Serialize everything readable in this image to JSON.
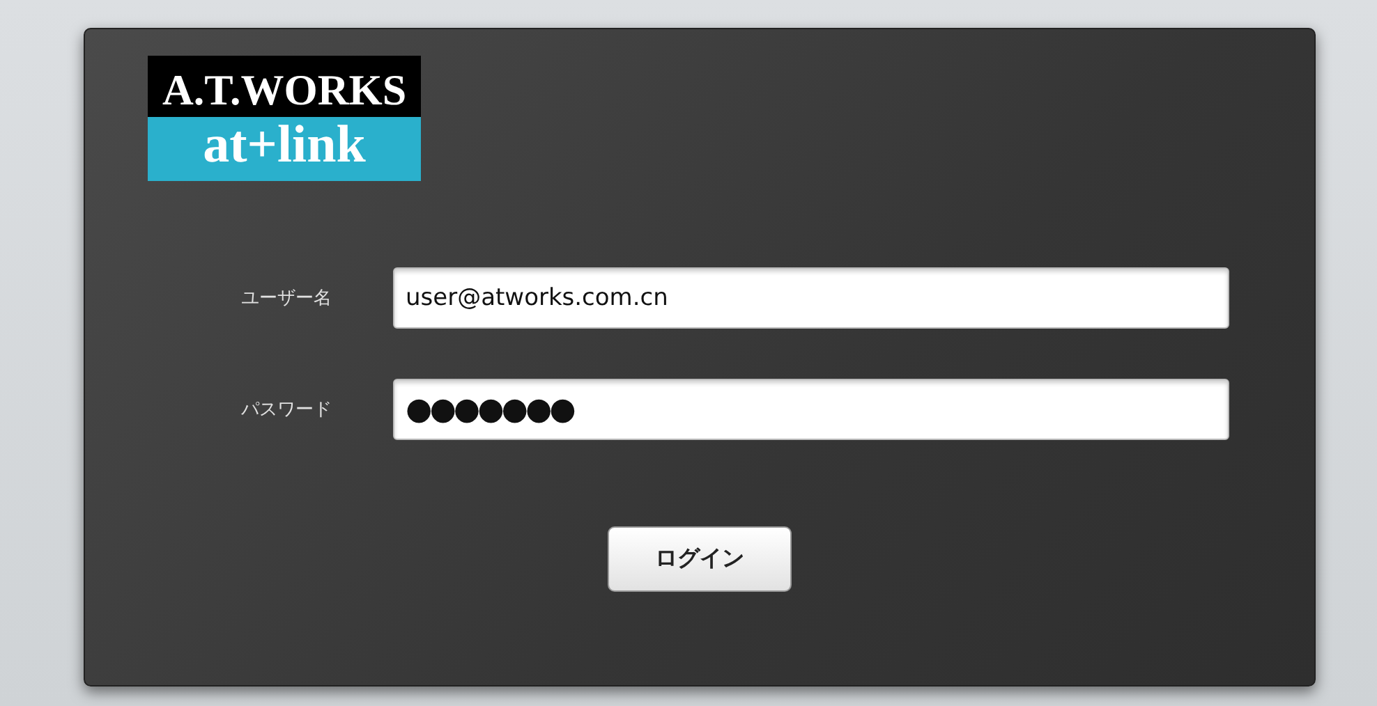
{
  "logo": {
    "top": "A.T.WORKS",
    "bottom": "at+link"
  },
  "fields": [
    {
      "label": "ユーザー名",
      "value": "user@atworks.com.cn",
      "kind": "text"
    },
    {
      "label": "パスワード",
      "value": "●●●●●●●",
      "kind": "password"
    }
  ],
  "button": "ログイン"
}
